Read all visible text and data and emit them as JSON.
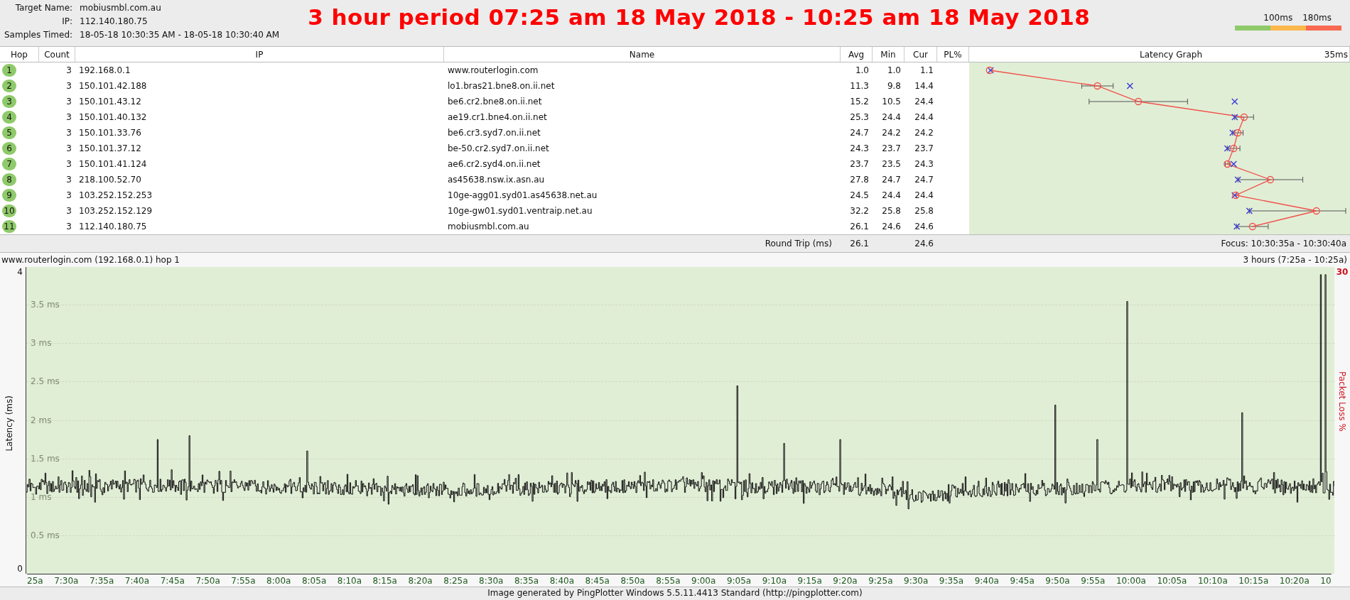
{
  "header": {
    "fields": [
      {
        "label": "Target Name:",
        "value": "mobiusmbl.com.au"
      },
      {
        "label": "IP:",
        "value": "112.140.180.75"
      },
      {
        "label": "Samples Timed:",
        "value": "18-05-18 10:30:35 AM - 18-05-18 10:30:40 AM"
      }
    ],
    "title": "3 hour period 07:25 am 18 May 2018 - 10:25 am 18 May 2018",
    "legend": {
      "labels": [
        "100ms",
        "180ms"
      ],
      "segments": [
        {
          "color": "#8fca6a"
        },
        {
          "color": "#fbb84d"
        },
        {
          "color": "#f86a51"
        }
      ]
    }
  },
  "table": {
    "columns": [
      "Hop",
      "Count",
      "IP",
      "Name",
      "Avg",
      "Min",
      "Cur",
      "PL%",
      "Latency Graph"
    ],
    "graph_scale": "35ms",
    "rows": [
      {
        "hop": "1",
        "count": "3",
        "ip": "192.168.0.1",
        "name": "www.routerlogin.com",
        "avg": "1.0",
        "min": "1.0",
        "cur": "1.1"
      },
      {
        "hop": "2",
        "count": "3",
        "ip": "150.101.42.188",
        "name": "lo1.bras21.bne8.on.ii.net",
        "avg": "11.3",
        "min": "9.8",
        "cur": "14.4"
      },
      {
        "hop": "3",
        "count": "3",
        "ip": "150.101.43.12",
        "name": "be6.cr2.bne8.on.ii.net",
        "avg": "15.2",
        "min": "10.5",
        "cur": "24.4"
      },
      {
        "hop": "4",
        "count": "3",
        "ip": "150.101.40.132",
        "name": "ae19.cr1.bne4.on.ii.net",
        "avg": "25.3",
        "min": "24.4",
        "cur": "24.4"
      },
      {
        "hop": "5",
        "count": "3",
        "ip": "150.101.33.76",
        "name": "be6.cr3.syd7.on.ii.net",
        "avg": "24.7",
        "min": "24.2",
        "cur": "24.2"
      },
      {
        "hop": "6",
        "count": "3",
        "ip": "150.101.37.12",
        "name": "be-50.cr2.syd7.on.ii.net",
        "avg": "24.3",
        "min": "23.7",
        "cur": "23.7"
      },
      {
        "hop": "7",
        "count": "3",
        "ip": "150.101.41.124",
        "name": "ae6.cr2.syd4.on.ii.net",
        "avg": "23.7",
        "min": "23.5",
        "cur": "24.3"
      },
      {
        "hop": "8",
        "count": "3",
        "ip": "218.100.52.70",
        "name": "as45638.nsw.ix.asn.au",
        "avg": "27.8",
        "min": "24.7",
        "cur": "24.7"
      },
      {
        "hop": "9",
        "count": "3",
        "ip": "103.252.152.253",
        "name": "10ge-agg01.syd01.as45638.net.au",
        "avg": "24.5",
        "min": "24.4",
        "cur": "24.4"
      },
      {
        "hop": "10",
        "count": "3",
        "ip": "103.252.152.129",
        "name": "10ge-gw01.syd01.ventraip.net.au",
        "avg": "32.2",
        "min": "25.8",
        "cur": "25.8"
      },
      {
        "hop": "11",
        "count": "3",
        "ip": "112.140.180.75",
        "name": "mobiusmbl.com.au",
        "avg": "26.1",
        "min": "24.6",
        "cur": "24.6"
      }
    ],
    "summary": {
      "label": "Round Trip (ms)",
      "avg": "26.1",
      "cur": "24.6",
      "focus": "Focus: 10:30:35a - 10:30:40a"
    }
  },
  "timeline": {
    "title": "www.routerlogin.com (192.168.0.1) hop 1",
    "range": "3 hours (7:25a - 10:25a)",
    "ylabel": "Latency (ms)",
    "y2label": "Packet Loss %",
    "y2max": "30",
    "ytop": "4",
    "ybottom": "0",
    "grid_labels": [
      "3.5 ms",
      "3 ms",
      "2.5 ms",
      "2 ms",
      "1.5 ms",
      "1 ms",
      "0.5 ms"
    ],
    "xlabels": [
      "25a",
      "7:30a",
      "7:35a",
      "7:40a",
      "7:45a",
      "7:50a",
      "7:55a",
      "8:00a",
      "8:05a",
      "8:10a",
      "8:15a",
      "8:20a",
      "8:25a",
      "8:30a",
      "8:35a",
      "8:40a",
      "8:45a",
      "8:50a",
      "8:55a",
      "9:00a",
      "9:05a",
      "9:10a",
      "9:15a",
      "9:20a",
      "9:25a",
      "9:30a",
      "9:35a",
      "9:40a",
      "9:45a",
      "9:50a",
      "9:55a",
      "10:00a",
      "10:05a",
      "10:10a",
      "10:15a",
      "10:20a",
      "10"
    ]
  },
  "footer": "Image generated by PingPlotter Windows 5.5.11.4413 Standard (http://pingplotter.com)"
}
